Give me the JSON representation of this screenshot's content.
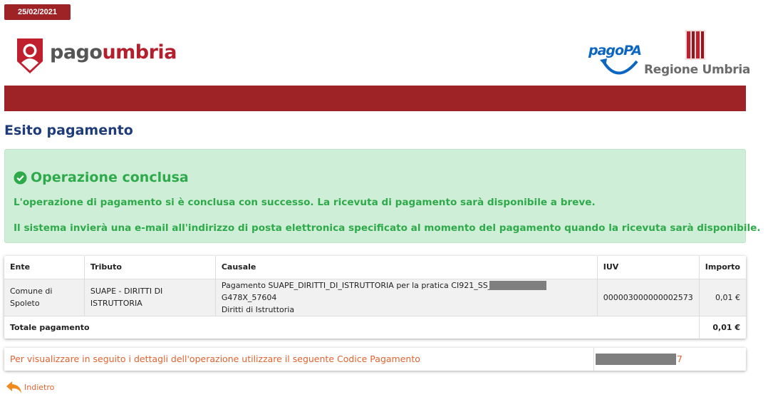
{
  "header": {
    "date": "25/02/2021",
    "brand_part1": "pago",
    "brand_part2": "umbria",
    "partner_logo": "pagoPA",
    "region_name": "Regione Umbria"
  },
  "page": {
    "title": "Esito pagamento"
  },
  "alert": {
    "title": "Operazione conclusa",
    "icon": "check-circle-icon",
    "line1": "L'operazione di pagamento si è conclusa con successo. La ricevuta di pagamento sarà disponibile a breve.",
    "line2": "Il sistema invierà una e-mail all'indirizzo di posta elettronica specificato al momento del pagamento quando la ricevuta sarà disponibile.",
    "color": "#2eaa4a"
  },
  "table": {
    "headers": [
      "Ente",
      "Tributo",
      "Causale",
      "IUV",
      "Importo"
    ],
    "row": {
      "ente": "Comune di Spoleto",
      "tributo": "SUAPE - DIRITTI DI ISTRUTTORIA",
      "causale_prefix": "Pagamento SUAPE_DIRITTI_DI_ISTRUTTORIA per la pratica CI921_SS_",
      "causale_suffix": "G478X_57604",
      "causale_line2": "Diritti di Istruttoria",
      "iuv": "000003000000002573",
      "importo": "0,01 €"
    },
    "total_label": "Totale pagamento",
    "total_value": "0,01 €"
  },
  "codice": {
    "label": "Per visualizzare in seguito i dettagli dell'operazione utilizzare il seguente Codice Pagamento",
    "value_tail": "7"
  },
  "back": {
    "label": "Indietro",
    "icon": "reply-arrow-icon"
  },
  "colors": {
    "brand_red": "#9d2327",
    "title_blue": "#1f3c7a",
    "link_orange": "#e0632f"
  }
}
